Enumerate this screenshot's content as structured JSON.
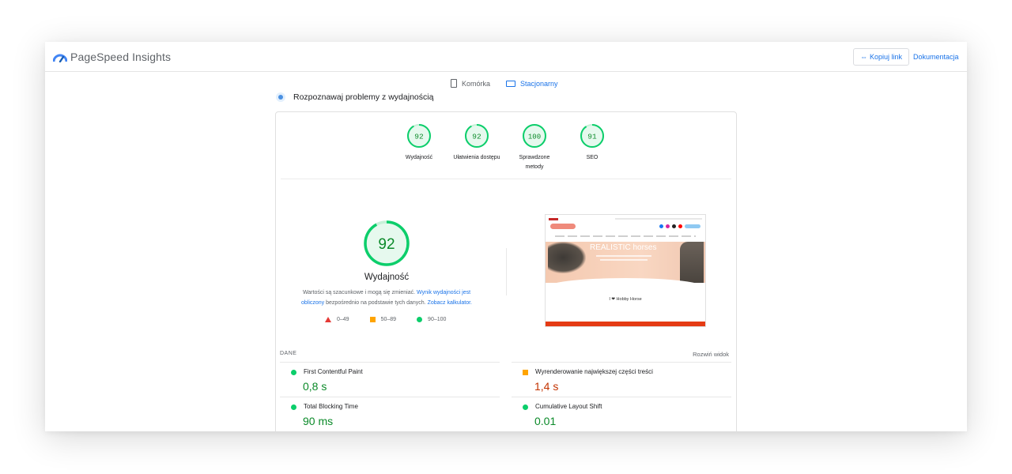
{
  "header": {
    "app_title": "PageSpeed Insights",
    "copy_link": "Kopiuj link",
    "docs": "Dokumentacja"
  },
  "device_tabs": [
    {
      "label": "Komórka",
      "active": false
    },
    {
      "label": "Stacjonarny",
      "active": true
    }
  ],
  "diagnose_label": "Rozpoznawaj problemy z wydajnością",
  "scores": [
    {
      "value": 92,
      "label": "Wydajność"
    },
    {
      "value": 92,
      "label": "Ułatwienia dostępu"
    },
    {
      "value": 100,
      "label": "Sprawdzone metody",
      "display": "100"
    },
    {
      "value": 91,
      "label": "SEO"
    }
  ],
  "performance": {
    "score": 92,
    "title": "Wydajność",
    "desc_part1": "Wartości są szacunkowe i mogą się zmieniać.",
    "desc_link1": "Wynik wydajności jest obliczony",
    "desc_part2": "bezpośrednio na podstawie tych danych.",
    "desc_link2": "Zobacz kalkulator."
  },
  "legend": {
    "poor": "0–49",
    "average": "50–89",
    "good": "90–100"
  },
  "screenshot": {
    "banner_title": "REALISTIC horses",
    "hobby_text": "I ❤ Hobby Horse"
  },
  "metrics_section": {
    "label": "DANE",
    "expand": "Rozwiń widok"
  },
  "metrics": [
    {
      "name": "First Contentful Paint",
      "value": "0,8 s",
      "status": "good"
    },
    {
      "name": "Wyrenderowanie największej części treści",
      "value": "1,4 s",
      "status": "average"
    },
    {
      "name": "Total Blocking Time",
      "value": "90 ms",
      "status": "good"
    },
    {
      "name": "Cumulative Layout Shift",
      "value": "0.01",
      "status": "good"
    }
  ],
  "colors": {
    "good": "#0cce6b",
    "good_text": "#0b8a29",
    "average": "#ffa400",
    "average_text": "#c33300",
    "poor": "#e53935",
    "link": "#1a73e8"
  }
}
